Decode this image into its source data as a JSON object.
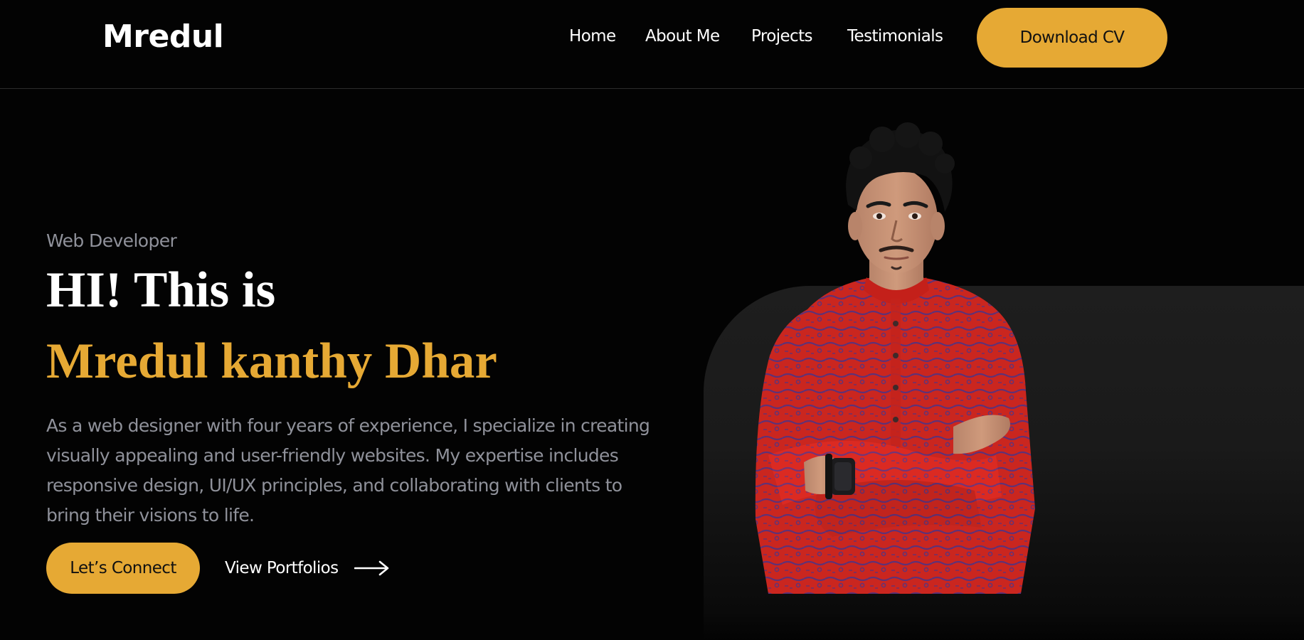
{
  "header": {
    "logo": "Mredul",
    "nav": [
      {
        "label": "Home"
      },
      {
        "label": "About Me"
      },
      {
        "label": "Projects"
      },
      {
        "label": "Testimonials"
      }
    ],
    "cta_label": "Download CV"
  },
  "hero": {
    "role": "Web Developer",
    "greeting": "HI! This is",
    "name": "Mredul kanthy Dhar",
    "bio": "As a web designer with four years of experience, I specialize in creating visually appealing and user-friendly websites. My expertise includes responsive design, UI/UX principles, and collaborating with clients to bring their visions to life.",
    "primary_button": "Let’s Connect",
    "secondary_link": "View Portfolios",
    "secondary_icon": "arrow-right-icon"
  },
  "colors": {
    "background": "#030303",
    "accent": "#e6a934",
    "muted_text": "#8f919a",
    "panel": "#1e1e1e",
    "shirt": "#dc2a22"
  }
}
